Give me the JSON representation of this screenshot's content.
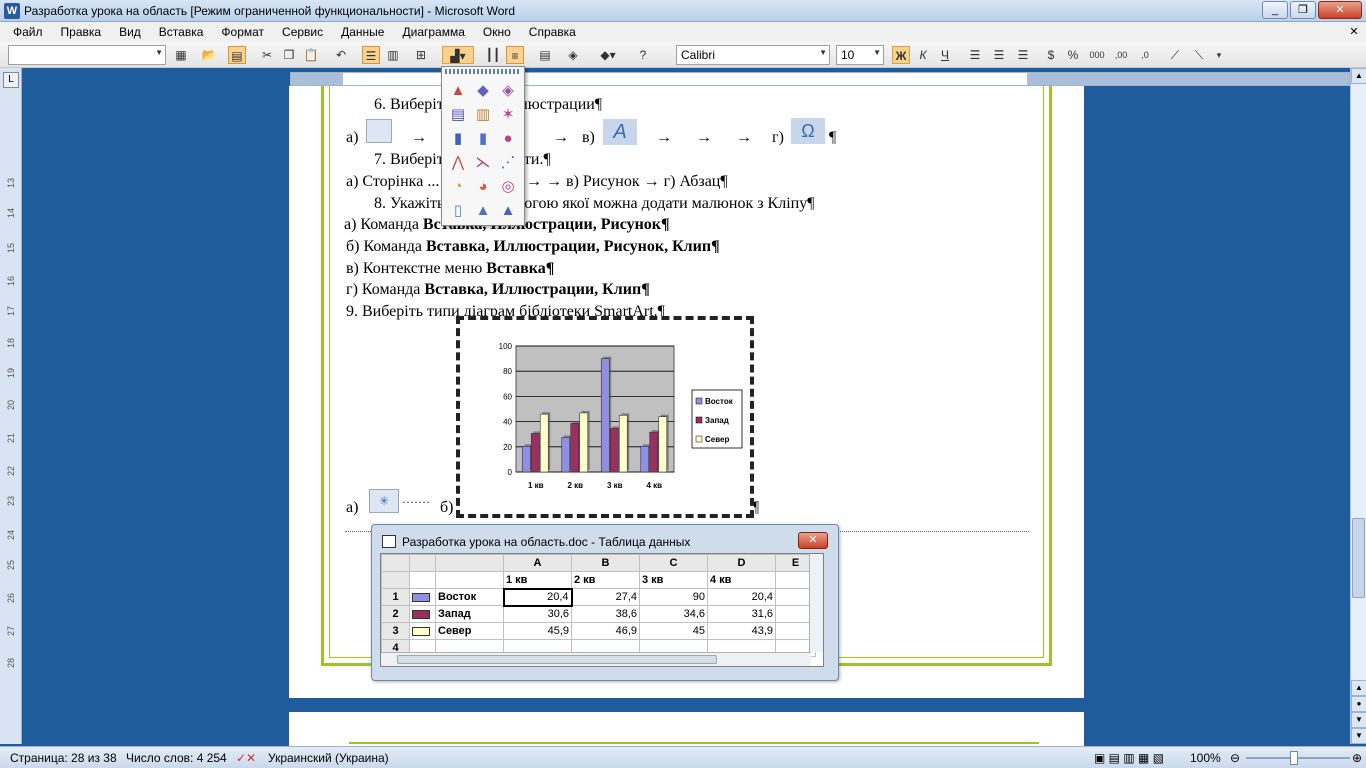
{
  "window": {
    "title": "Разработка урока на область [Режим ограниченной функциональности] - Microsoft Word"
  },
  "menu": [
    "Файл",
    "Правка",
    "Вид",
    "Вставка",
    "Формат",
    "Сервис",
    "Данные",
    "Диаграмма",
    "Окно",
    "Справка"
  ],
  "toolbar": {
    "font_name": "Calibri",
    "font_size": "10"
  },
  "document": {
    "line6": "6. Виберіть ... групи Ілюстрации¶",
    "line6_opts": [
      "а)",
      "в)",
      "г)"
    ],
    "line7": "7. Виберіть ... ні об’єкти.¶",
    "line7_opts": "а) Сторінка ... б) Діаграма → → в) Рисунок → г) Абзац¶",
    "line8": "8. Укажіть ... за допомогою якої можна додати малюнок з Кліпу¶",
    "opt_a_prefix": "а) Команда ",
    "opt_a_bold": "Вставка, Иллюстрации, Рисунок¶",
    "opt_b_prefix": "б) Команда ",
    "opt_b_bold": "Вставка, Иллюстрации, Рисунок, Клип¶",
    "opt_v_prefix": "в) Контекстне меню ",
    "opt_v_bold": "Вставка¶",
    "opt_g_prefix": "г) Команда ",
    "opt_g_bold": "Вставка, Иллюстрации, Клип¶",
    "line9": "9. Виберіть типи діаграм бібліотеки SmartArt.¶",
    "answer_line_a": "а)",
    "answer_line_b": "б)",
    "pilcrow": "¶"
  },
  "datasheet": {
    "title": "Разработка урока на область.doc - Таблица данных",
    "columns": [
      "A",
      "B",
      "C",
      "D",
      "E"
    ],
    "header_row": [
      "1 кв",
      "2 кв",
      "3 кв",
      "4 кв"
    ],
    "rows": [
      {
        "num": "1",
        "name": "Восток",
        "values": [
          "20,4",
          "27,4",
          "90",
          "20,4"
        ]
      },
      {
        "num": "2",
        "name": "Запад",
        "values": [
          "30,6",
          "38,6",
          "34,6",
          "31,6"
        ]
      },
      {
        "num": "3",
        "name": "Север",
        "values": [
          "45,9",
          "46,9",
          "45",
          "43,9"
        ]
      },
      {
        "num": "4",
        "name": "",
        "values": [
          "",
          "",
          "",
          ""
        ]
      }
    ]
  },
  "chart_data": {
    "type": "bar",
    "categories": [
      "1 кв",
      "2 кв",
      "3 кв",
      "4 кв"
    ],
    "series": [
      {
        "name": "Восток",
        "values": [
          20.4,
          27.4,
          90,
          20.4
        ],
        "color": "#8f8fe8"
      },
      {
        "name": "Запад",
        "values": [
          30.6,
          38.6,
          34.6,
          31.6
        ],
        "color": "#9b3060"
      },
      {
        "name": "Север",
        "values": [
          45.9,
          46.9,
          45,
          43.9
        ],
        "color": "#ffffcc"
      }
    ],
    "ylim": [
      0,
      100
    ],
    "yticks": [
      "0",
      "20",
      "40",
      "60",
      "80",
      "100"
    ],
    "legend": "right",
    "plot_background": "#c0c0c0"
  },
  "statusbar": {
    "page": "Страница: 28 из 38",
    "words": "Число слов: 4 254",
    "language": "Украинский (Украина)",
    "zoom": "100%"
  }
}
